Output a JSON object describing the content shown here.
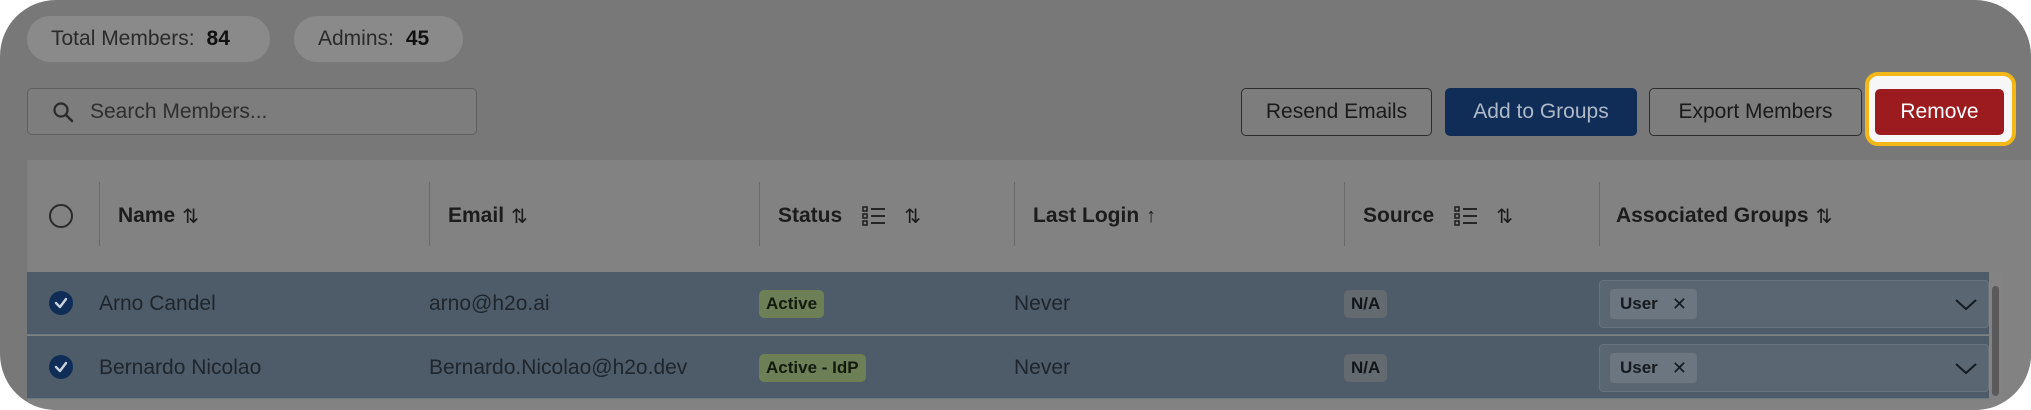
{
  "stats": {
    "total_label": "Total Members:",
    "total_value": "84",
    "admins_label": "Admins:",
    "admins_value": "45"
  },
  "search": {
    "placeholder": "Search Members..."
  },
  "toolbar": {
    "resend_label": "Resend Emails",
    "add_groups_label": "Add to Groups",
    "export_label": "Export Members",
    "remove_label": "Remove"
  },
  "table": {
    "columns": {
      "name": "Name",
      "email": "Email",
      "status": "Status",
      "last_login": "Last Login",
      "source": "Source",
      "groups": "Associated Groups"
    },
    "rows": [
      {
        "name": "Arno Candel",
        "email": "arno@h2o.ai",
        "status": "Active",
        "last_login": "Never",
        "source": "N/A",
        "group": "User"
      },
      {
        "name": "Bernardo Nicolao",
        "email": "Bernardo.Nicolao@h2o.dev",
        "status": "Active - IdP",
        "last_login": "Never",
        "source": "N/A",
        "group": "User"
      }
    ]
  },
  "icons": {
    "search": "search-icon",
    "sort": "sort-arrows-icon",
    "sort_asc": "sort-up-icon",
    "filter": "filter-list-icon",
    "check": "check-icon",
    "remove_chip": "close-icon",
    "dropdown": "chevron-down-icon"
  },
  "colors": {
    "primary": "#0f2d57",
    "danger": "#9c1b1f",
    "highlight": "#f3b817"
  }
}
